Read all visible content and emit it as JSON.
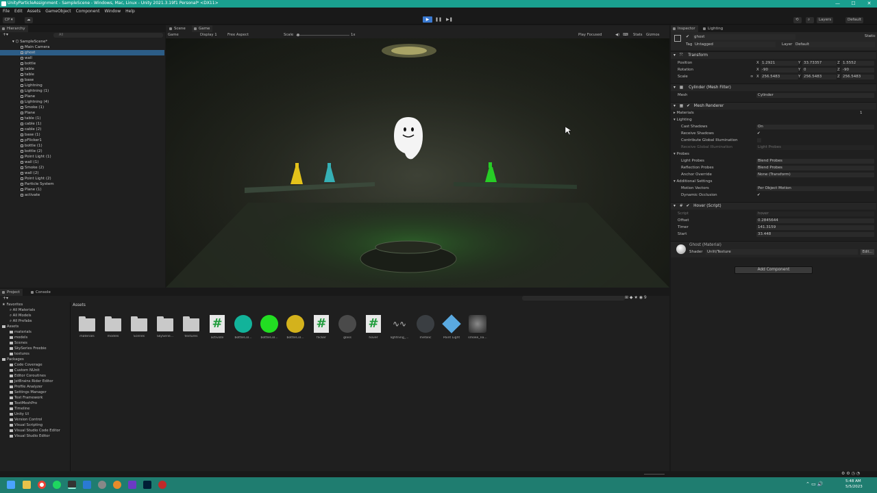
{
  "window": {
    "title": "UnityParticleAssignment - SampleScene - Windows, Mac, Linux - Unity 2021.3.19f1 Personal* <DX11>",
    "controls": [
      "—",
      "☐",
      "✕"
    ]
  },
  "menu": [
    "File",
    "Edit",
    "Assets",
    "GameObject",
    "Component",
    "Window",
    "Help"
  ],
  "toolbar": {
    "account": "CP ▾",
    "layers": "Layers",
    "layout": "Default",
    "play": "▶",
    "pause": "❚❚",
    "step": "▶❚"
  },
  "hierarchy": {
    "tab": "Hierarchy",
    "search_placeholder": "All",
    "scene": "SampleScene*",
    "items": [
      "Main Camera",
      "ghost",
      "wall",
      "bottle",
      "table",
      "table",
      "base",
      "Lightning",
      "Lightning (1)",
      "Plane",
      "Lightning (4)",
      "Smoke (1)",
      "Plane",
      "table (1)",
      "cable (1)",
      "cable (2)",
      "base (1)",
      "pFlicker1",
      "bottle (1)",
      "bottle (2)",
      "Point Light (1)",
      "wall (1)",
      "Smoke (2)",
      "wall (2)",
      "Point Light (2)",
      "Particle System",
      "Plane (1)",
      "activate"
    ],
    "selected_index": 1
  },
  "scene_tabs": {
    "scene": "Scene",
    "game": "Game"
  },
  "game_toolbar": {
    "mode": "Game",
    "display": "Display 1",
    "aspect": "Free Aspect",
    "scale_label": "Scale",
    "scale_value": "1x",
    "play_focused": "Play Focused",
    "stats": "Stats",
    "gizmos": "Gizmos"
  },
  "inspector": {
    "tabs": [
      "Inspector",
      "Lighting"
    ],
    "object_name": "ghost",
    "static_label": "Static",
    "tag_label": "Tag",
    "tag_value": "Untagged",
    "layer_label": "Layer",
    "layer_value": "Default",
    "transform": {
      "title": "Transform",
      "position_label": "Position",
      "position": {
        "x": "1.2921",
        "y": "33.73357",
        "z": "1.5552"
      },
      "rotation_label": "Rotation",
      "rotation": {
        "x": "-90",
        "y": "0",
        "z": "-90"
      },
      "scale_label": "Scale",
      "scale": {
        "x": "256.5483",
        "y": "256.5483",
        "z": "256.5483"
      }
    },
    "mesh_filter": {
      "title": "Cylinder (Mesh Filter)",
      "mesh_label": "Mesh",
      "mesh_value": "Cylinder"
    },
    "mesh_renderer": {
      "title": "Mesh Renderer",
      "materials_label": "Materials",
      "materials_count": "1",
      "lighting_label": "Lighting",
      "cast_shadows_label": "Cast Shadows",
      "cast_shadows_value": "On",
      "receive_shadows_label": "Receive Shadows",
      "contribute_gi_label": "Contribute Global Illumination",
      "receive_gi_label": "Receive Global Illumination",
      "receive_gi_value": "Light Probes",
      "probes_label": "Probes",
      "light_probes_label": "Light Probes",
      "light_probes_value": "Blend Probes",
      "reflection_probes_label": "Reflection Probes",
      "reflection_probes_value": "Blend Probes",
      "anchor_override_label": "Anchor Override",
      "anchor_override_value": "None (Transform)",
      "additional_label": "Additional Settings",
      "motion_vectors_label": "Motion Vectors",
      "motion_vectors_value": "Per Object Motion",
      "dynamic_occlusion_label": "Dynamic Occlusion"
    },
    "hover_script": {
      "title": "Hover (Script)",
      "script_label": "Script",
      "script_value": "hover",
      "offset_label": "Offset",
      "offset_value": "0.2845644",
      "timer_label": "Timer",
      "timer_value": "141.3159",
      "start_label": "Start",
      "start_value": "33.448"
    },
    "material": {
      "title": "Ghost (Material)",
      "shader_label": "Shader",
      "shader_value": "Unlit/Texture",
      "edit": "Edit..."
    },
    "add_component": "Add Component"
  },
  "project": {
    "tabs": [
      "Project",
      "Console"
    ],
    "favorites_label": "Favorites",
    "favorites": [
      "All Materials",
      "All Models",
      "All Prefabs"
    ],
    "assets_label": "Assets",
    "asset_folders": [
      "materials",
      "models",
      "Scenes",
      "SkySeries Freebie",
      "textures"
    ],
    "packages_label": "Packages",
    "packages": [
      "Code Coverage",
      "Custom NUnit",
      "Editor Coroutines",
      "JetBrains Rider Editor",
      "Profile Analyzer",
      "Settings Manager",
      "Test Framework",
      "TextMeshPro",
      "Timeline",
      "Unity UI",
      "Version Control",
      "Visual Scripting",
      "Visual Studio Code Editor",
      "Visual Studio Editor"
    ],
    "breadcrumb": "Assets",
    "grid": [
      {
        "label": "materials",
        "kind": "folder"
      },
      {
        "label": "models",
        "kind": "folder"
      },
      {
        "label": "Scenes",
        "kind": "folder"
      },
      {
        "label": "SkySerie...",
        "kind": "folder"
      },
      {
        "label": "textures",
        "kind": "folder"
      },
      {
        "label": "activate",
        "kind": "script"
      },
      {
        "label": "bottleCol...",
        "kind": "material",
        "color": "#12b39a"
      },
      {
        "label": "bottleCol...",
        "kind": "material",
        "color": "#22dd22"
      },
      {
        "label": "bottleCol...",
        "kind": "material",
        "color": "#d4b21c"
      },
      {
        "label": "flicker",
        "kind": "script"
      },
      {
        "label": "glass",
        "kind": "material",
        "color": "#4a4a4a"
      },
      {
        "label": "hover",
        "kind": "script"
      },
      {
        "label": "lightning_...",
        "kind": "wave"
      },
      {
        "label": "metalic",
        "kind": "material",
        "color": "#3a3e42"
      },
      {
        "label": "Point Light",
        "kind": "prefab"
      },
      {
        "label": "smoke_na...",
        "kind": "smoke"
      }
    ]
  },
  "taskbar": {
    "time": "5:48 AM",
    "date": "5/5/2023"
  },
  "colors": {
    "accent": "#1aa08f",
    "selection": "#2c5d87",
    "play_active": "#3a79d0"
  }
}
